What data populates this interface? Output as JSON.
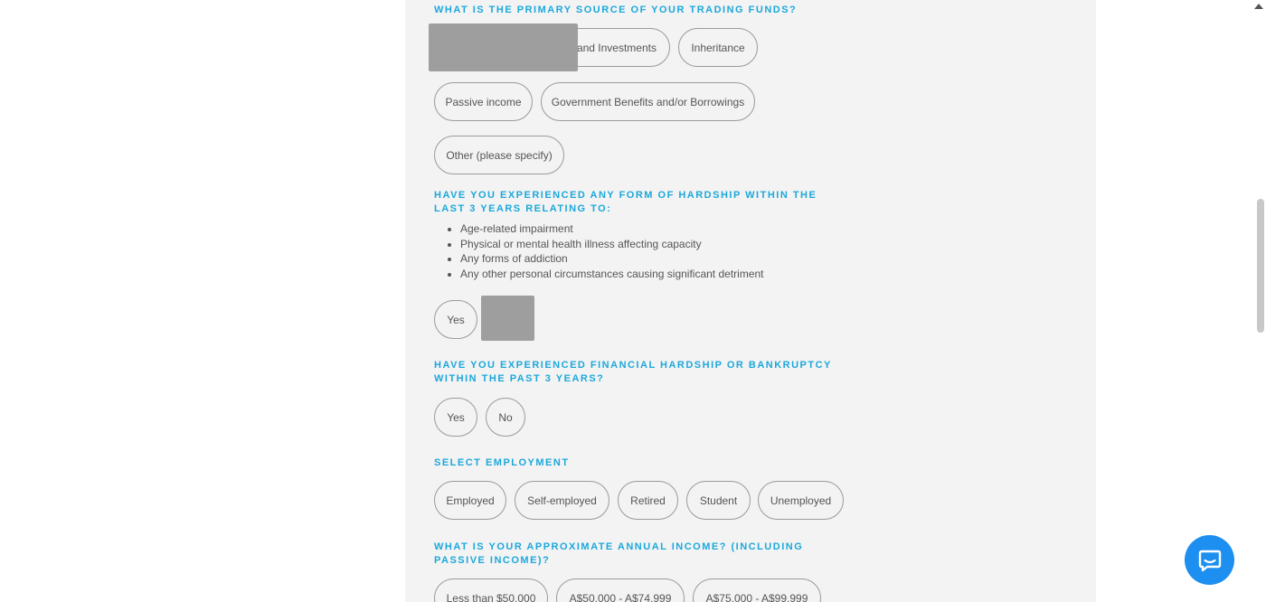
{
  "questions": {
    "funds": {
      "title": "WHAT IS THE PRIMARY SOURCE OF YOUR TRADING FUNDS?",
      "options": [
        "and Investments",
        "Inheritance",
        "Passive income",
        "Government Benefits and/or Borrowings",
        "Other (please specify)"
      ]
    },
    "hardship": {
      "title": "HAVE YOU EXPERIENCED ANY FORM OF HARDSHIP WITHIN THE LAST 3 YEARS RELATING TO:",
      "bullets": [
        "Age-related impairment",
        "Physical or mental health illness affecting capacity",
        "Any forms of addiction",
        "Any other personal circumstances causing significant detriment"
      ],
      "yes": "Yes"
    },
    "bankruptcy": {
      "title": "HAVE YOU EXPERIENCED FINANCIAL HARDSHIP OR BANKRUPTCY WITHIN THE PAST 3 YEARS?",
      "yes": "Yes",
      "no": "No"
    },
    "employment": {
      "title": "SELECT EMPLOYMENT",
      "options": [
        "Employed",
        "Self-employed",
        "Retired",
        "Student",
        "Unemployed"
      ]
    },
    "income": {
      "title": "WHAT IS YOUR APPROXIMATE ANNUAL INCOME? (INCLUDING PASSIVE INCOME)?",
      "options": [
        "Less than $50,000",
        "A$50,000 - A$74,999",
        "A$75,000 - A$99,999"
      ]
    }
  },
  "colors": {
    "accent": "#1ba8dc",
    "chat": "#1d8ff0",
    "panel": "#f3f3f3"
  },
  "icons": {
    "chat": "chat-bubble-icon"
  }
}
